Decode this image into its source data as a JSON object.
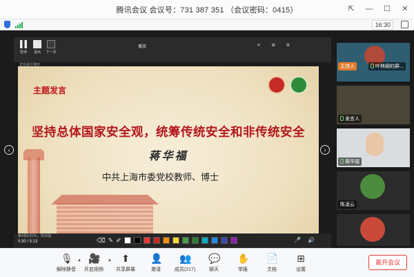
{
  "window": {
    "title": "腾讯会议 会议号：731 387 351 （会议密码：0415）"
  },
  "status": {
    "time": "16:30"
  },
  "ppt_toolbar": {
    "buttons": [
      "暂停",
      "退出",
      "下一页"
    ],
    "slide_info": "正在进行演示",
    "middle_label": "播放"
  },
  "slide": {
    "topic_label": "主题发言",
    "title": "坚持总体国家安全观，统筹传统安全和非传统安全",
    "speaker": "蒋华福",
    "affiliation": "中共上海市委党校教师、博士",
    "page_info": "第4张幻灯片，共29张",
    "time": "0:30 / 5:13"
  },
  "pen_colors": [
    "#ffffff",
    "#000000",
    "#e53935",
    "#c62828",
    "#fb8c00",
    "#fdd835",
    "#43a047",
    "#2e7d32",
    "#00acc1",
    "#1e88e5",
    "#3949ab",
    "#8e24aa"
  ],
  "participants": [
    {
      "name": "叶林纲的屏...",
      "role": "主持人"
    },
    {
      "name": "发言人",
      "role": ""
    },
    {
      "name": "蒋华福",
      "role": ""
    },
    {
      "name": "陈凌云",
      "role": ""
    },
    {
      "name": "",
      "role": ""
    }
  ],
  "toolbar": {
    "mute": "解除静音",
    "video": "开启视频",
    "share": "共享屏幕",
    "invite": "邀请",
    "members": "成员(217)",
    "chat": "聊天",
    "raise_hand": "举报",
    "docs": "文档",
    "settings": "设置",
    "leave": "离开会议"
  }
}
